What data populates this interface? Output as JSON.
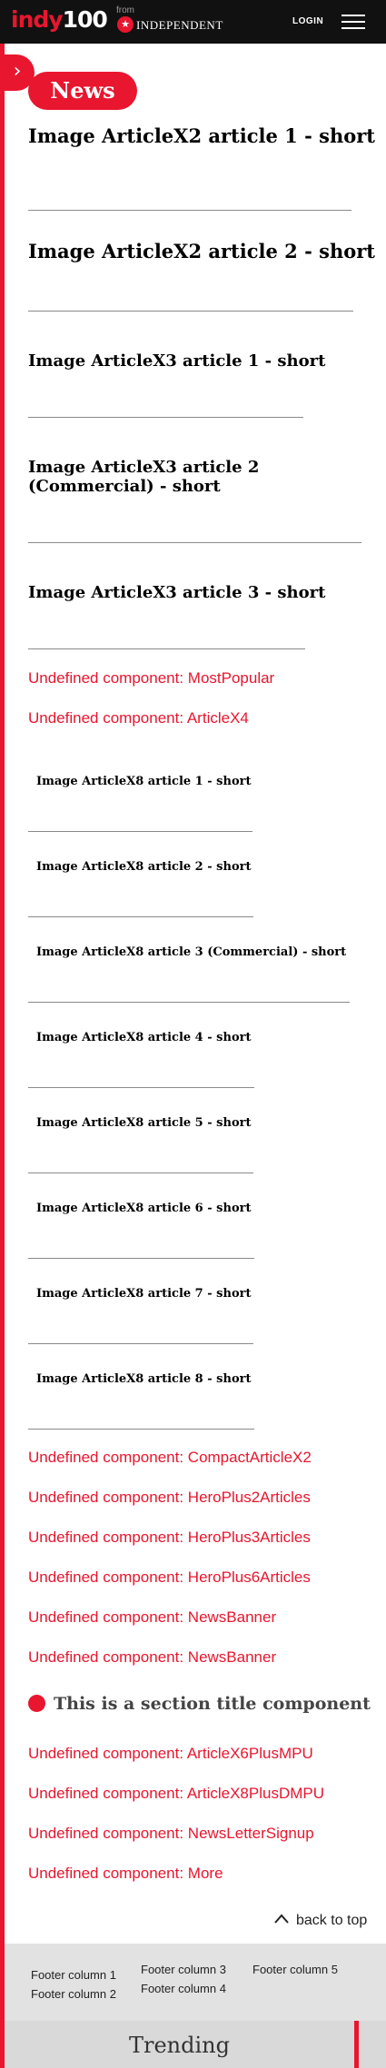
{
  "header": {
    "logo_text": "indy",
    "logo_number": "100",
    "from_text": "from",
    "brand": "INDEPENDENT",
    "login_label": "LOGIN",
    "menu_icon": "hamburger-menu-icon"
  },
  "rail": {
    "toggle_icon": "chevron-right-icon"
  },
  "section": {
    "label": "News"
  },
  "articles": [
    {
      "title": "Image ArticleX2 article 1 - short"
    },
    {
      "title": "Image ArticleX2 article 2 - short"
    },
    {
      "title": "Image ArticleX3 article 1 - short"
    },
    {
      "title": "Image ArticleX3 article 2 (Commercial) - short"
    },
    {
      "title": "Image ArticleX3 article 3 - short"
    }
  ],
  "undefined_1": [
    "Undefined component: MostPopular",
    "Undefined component: ArticleX4"
  ],
  "x8_articles": [
    {
      "title": "Image ArticleX8 article 1 - short"
    },
    {
      "title": "Image ArticleX8 article 2 - short"
    },
    {
      "title": "Image ArticleX8 article 3 (Commercial) - short"
    },
    {
      "title": "Image ArticleX8 article 4 - short"
    },
    {
      "title": "Image ArticleX8 article 5 - short"
    },
    {
      "title": "Image ArticleX8 article 6 - short"
    },
    {
      "title": "Image ArticleX8 article 7 - short"
    },
    {
      "title": "Image ArticleX8 article 8 - short"
    }
  ],
  "undefined_2": [
    "Undefined component: CompactArticleX2",
    "Undefined component: HeroPlus2Articles",
    "Undefined component: HeroPlus3Articles",
    "Undefined component: HeroPlus6Articles",
    "Undefined component: NewsBanner",
    "Undefined component: NewsBanner"
  ],
  "section_title": "This is a section title component",
  "undefined_3": [
    "Undefined component: ArticleX6PlusMPU",
    "Undefined component: ArticleX8PlusDMPU",
    "Undefined component: NewsLetterSignup",
    "Undefined component: More"
  ],
  "back_to_top": {
    "icon": "chevron-up-icon",
    "label": "back to top"
  },
  "footer": {
    "columns": [
      "Footer column 1",
      "Footer column 2",
      "Footer column 3",
      "Footer column 4",
      "Footer column 5"
    ]
  },
  "trending": {
    "label": "Trending"
  },
  "colors": {
    "accent": "#e8162e",
    "header_bg": "#111111",
    "footer_bg": "#e2e2e2"
  }
}
